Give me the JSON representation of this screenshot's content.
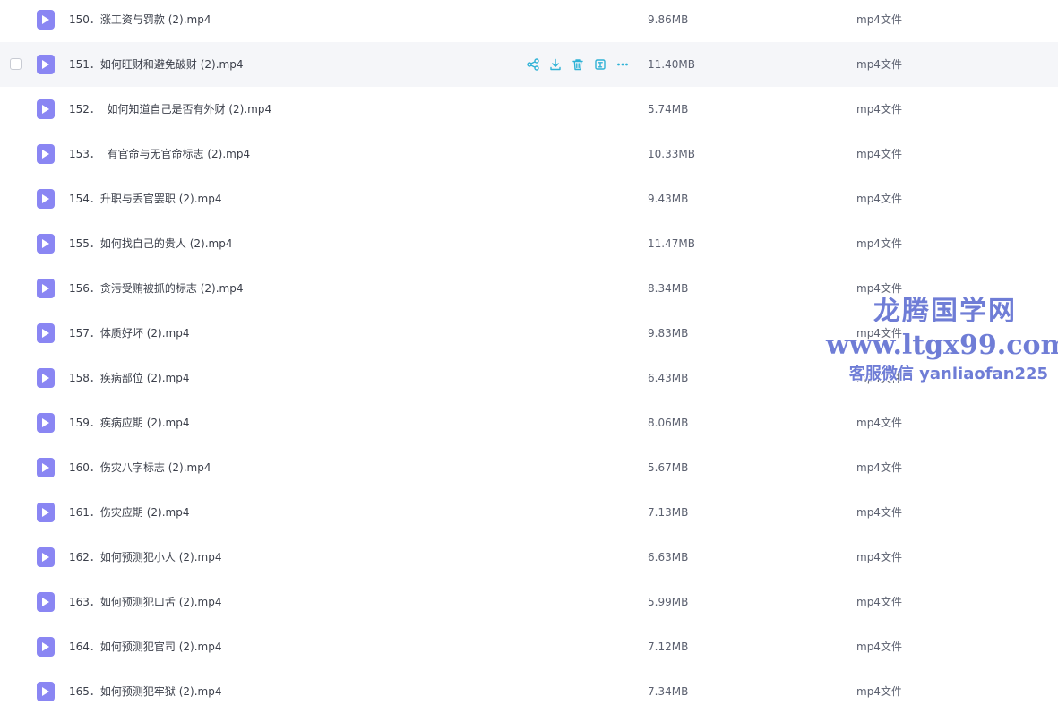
{
  "colors": {
    "accent": "#2fb2d6",
    "video_icon": "#8a86f3",
    "hover_row": "#f5f6f9",
    "watermark": "#6f7dd6"
  },
  "row_actions": [
    {
      "icon": "share-icon"
    },
    {
      "icon": "download-icon"
    },
    {
      "icon": "delete-icon"
    },
    {
      "icon": "text-extract-icon"
    },
    {
      "icon": "more-icon"
    }
  ],
  "files": [
    {
      "name": "150．涨工资与罚款 (2).mp4",
      "size": "9.86MB",
      "type": "mp4文件",
      "icon": "video-file-icon",
      "hovered": false
    },
    {
      "name": "151．如何旺财和避免破财 (2).mp4",
      "size": "11.40MB",
      "type": "mp4文件",
      "icon": "video-file-icon",
      "hovered": true
    },
    {
      "name": "152．  如何知道自己是否有外财 (2).mp4",
      "size": "5.74MB",
      "type": "mp4文件",
      "icon": "video-file-icon",
      "hovered": false
    },
    {
      "name": "153．  有官命与无官命标志 (2).mp4",
      "size": "10.33MB",
      "type": "mp4文件",
      "icon": "video-file-icon",
      "hovered": false
    },
    {
      "name": "154．升职与丢官罢职 (2).mp4",
      "size": "9.43MB",
      "type": "mp4文件",
      "icon": "video-file-icon",
      "hovered": false
    },
    {
      "name": "155．如何找自己的贵人 (2).mp4",
      "size": "11.47MB",
      "type": "mp4文件",
      "icon": "video-file-icon",
      "hovered": false
    },
    {
      "name": "156．贪污受贿被抓的标志 (2).mp4",
      "size": "8.34MB",
      "type": "mp4文件",
      "icon": "video-file-icon",
      "hovered": false
    },
    {
      "name": "157．体质好坏 (2).mp4",
      "size": "9.83MB",
      "type": "mp4文件",
      "icon": "video-file-icon",
      "hovered": false
    },
    {
      "name": "158．疾病部位 (2).mp4",
      "size": "6.43MB",
      "type": "mp4文件",
      "icon": "video-file-icon",
      "hovered": false
    },
    {
      "name": "159．疾病应期 (2).mp4",
      "size": "8.06MB",
      "type": "mp4文件",
      "icon": "video-file-icon",
      "hovered": false
    },
    {
      "name": "160．伤灾八字标志 (2).mp4",
      "size": "5.67MB",
      "type": "mp4文件",
      "icon": "video-file-icon",
      "hovered": false
    },
    {
      "name": "161．伤灾应期 (2).mp4",
      "size": "7.13MB",
      "type": "mp4文件",
      "icon": "video-file-icon",
      "hovered": false
    },
    {
      "name": "162．如何预测犯小人 (2).mp4",
      "size": "6.63MB",
      "type": "mp4文件",
      "icon": "video-file-icon",
      "hovered": false
    },
    {
      "name": "163．如何预测犯口舌 (2).mp4",
      "size": "5.99MB",
      "type": "mp4文件",
      "icon": "video-file-icon",
      "hovered": false
    },
    {
      "name": "164．如何预测犯官司 (2).mp4",
      "size": "7.12MB",
      "type": "mp4文件",
      "icon": "video-file-icon",
      "hovered": false
    },
    {
      "name": "165．如何预测犯牢狱 (2).mp4",
      "size": "7.34MB",
      "type": "mp4文件",
      "icon": "video-file-icon",
      "hovered": false
    }
  ],
  "watermark": {
    "title": "龙腾国学网",
    "url": "www.ltgx99.com",
    "contact": "客服微信 yanliaofan225"
  }
}
